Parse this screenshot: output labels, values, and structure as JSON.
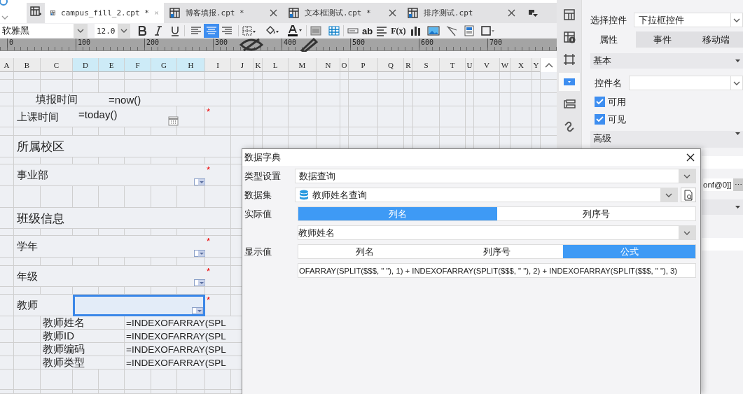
{
  "file_tabs": [
    {
      "label": "campus_fill_2.cpt *",
      "selected": true
    },
    {
      "label": "博客填报.cpt *",
      "selected": false
    },
    {
      "label": "文本框测试.cpt *",
      "selected": false
    },
    {
      "label": "排序测试.cpt",
      "selected": false
    }
  ],
  "toolbar": {
    "font": "软雅黑",
    "size": "12.0",
    "align": [
      {
        "selected": false
      },
      {
        "selected": true
      },
      {
        "selected": false
      }
    ],
    "text_tool": "ab",
    "formula_tool": "F(x)"
  },
  "ruler": {
    "labels": [
      "0",
      "100",
      "200",
      "300",
      "400",
      "500",
      "600",
      "700"
    ]
  },
  "sheet": {
    "columns": [
      {
        "label": "A",
        "selected": false
      },
      {
        "label": "B",
        "selected": false
      },
      {
        "label": "C",
        "selected": false
      },
      {
        "label": "D",
        "selected": true
      },
      {
        "label": "E",
        "selected": true
      },
      {
        "label": "F",
        "selected": true
      },
      {
        "label": "G",
        "selected": true
      },
      {
        "label": "H",
        "selected": true
      },
      {
        "label": "I",
        "selected": false
      },
      {
        "label": "J",
        "selected": false
      },
      {
        "label": "K",
        "selected": false
      },
      {
        "label": "L",
        "selected": false
      },
      {
        "label": "M",
        "selected": false
      },
      {
        "label": "N",
        "selected": false
      },
      {
        "label": "O",
        "selected": false
      },
      {
        "label": "P",
        "selected": false
      },
      {
        "label": "Q",
        "selected": false
      },
      {
        "label": "R",
        "selected": false
      },
      {
        "label": "S",
        "selected": false
      },
      {
        "label": "T",
        "selected": false
      },
      {
        "label": "U",
        "selected": false
      },
      {
        "label": "V",
        "selected": false
      },
      {
        "label": "W",
        "selected": false
      },
      {
        "label": "X",
        "selected": false
      },
      {
        "label": "Y",
        "selected": false
      }
    ],
    "rows": [
      {
        "kind": "formula",
        "label": "填报时间",
        "value": "=now()"
      },
      {
        "kind": "date",
        "label": "上课时间",
        "value": "=today()",
        "required_mark": "*"
      },
      {
        "kind": "section",
        "label": "所属校区"
      },
      {
        "kind": "dropdown",
        "label": "事业部",
        "required_mark": "*",
        "selected": false
      },
      {
        "kind": "section",
        "label": "班级信息"
      },
      {
        "kind": "dropdown",
        "label": "学年",
        "required_mark": "*",
        "selected": false
      },
      {
        "kind": "dropdown",
        "label": "年级",
        "required_mark": "*",
        "selected": false
      },
      {
        "kind": "dropdown",
        "label": "教师",
        "required_mark": "*",
        "selected": true
      },
      {
        "kind": "sub",
        "label": "教师姓名",
        "value": "=INDEXOFARRAY(SPL"
      },
      {
        "kind": "sub",
        "label": "教师ID",
        "value": "=INDEXOFARRAY(SPL"
      },
      {
        "kind": "sub",
        "label": "教师编码",
        "value": "=INDEXOFARRAY(SPL"
      },
      {
        "kind": "sub",
        "label": "教师类型",
        "value": "=INDEXOFARRAY(SPL"
      }
    ]
  },
  "side_strip": {
    "items": [
      {
        "selected": false
      },
      {
        "selected": false
      },
      {
        "selected": false
      },
      {
        "selected": true
      },
      {
        "selected": false
      },
      {
        "selected": false
      }
    ]
  },
  "properties": {
    "selector_label": "选择控件",
    "selector_value": "下拉框控件",
    "tabs": [
      {
        "label": "属性",
        "selected": true
      },
      {
        "label": "事件",
        "selected": false
      },
      {
        "label": "移动端",
        "selected": false
      }
    ],
    "basic_title": "基本",
    "name_label": "控件名",
    "checks": [
      {
        "label": "可用",
        "checked": true
      },
      {
        "label": "可见",
        "checked": true
      }
    ],
    "advanced_title": "高级",
    "field_value": "onf@0]]",
    "more_button": "⋯"
  },
  "dialog": {
    "title": "数据字典",
    "type_label": "类型设置",
    "type_value": "数据查询",
    "dataset_label": "数据集",
    "dataset_value": "教师姓名查询",
    "actual_label": "实际值",
    "actual_modes": [
      {
        "label": "列名",
        "selected": true
      },
      {
        "label": "列序号",
        "selected": false
      }
    ],
    "actual_column": "教师姓名",
    "display_label": "显示值",
    "display_modes": [
      {
        "label": "列名",
        "selected": false
      },
      {
        "label": "列序号",
        "selected": false
      },
      {
        "label": "公式",
        "selected": true
      }
    ],
    "formula": "OFARRAY(SPLIT($$$, \" \"), 1) + INDEXOFARRAY(SPLIT($$$, \" \"), 2) + INDEXOFARRAY(SPLIT($$$, \" \"), 3)"
  }
}
